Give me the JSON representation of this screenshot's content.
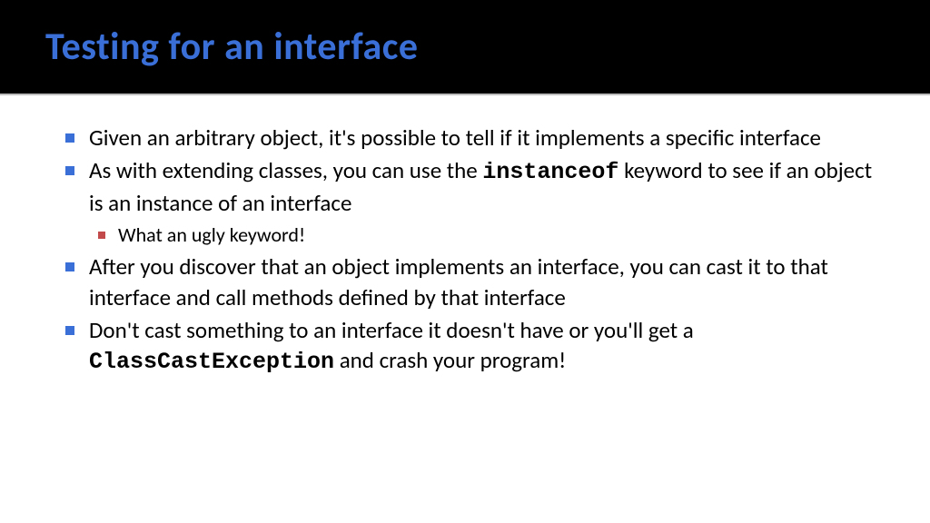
{
  "slide": {
    "title": "Testing for an interface",
    "bullets": [
      {
        "pre": "Given an arbitrary object, it's possible to tell if it implements a specific interface"
      },
      {
        "pre": "As with extending classes, you can use the ",
        "code": "instanceof",
        "post": " keyword to see if an object is an instance of an interface",
        "sub": [
          {
            "text": "What an ugly keyword!"
          }
        ]
      },
      {
        "pre": "After you discover that an object implements an interface, you can cast it to that interface and call methods defined by that interface"
      },
      {
        "pre": "Don't cast something to an interface it doesn't have or you'll get a ",
        "code": "ClassCastException",
        "post": " and crash your program!"
      }
    ]
  }
}
